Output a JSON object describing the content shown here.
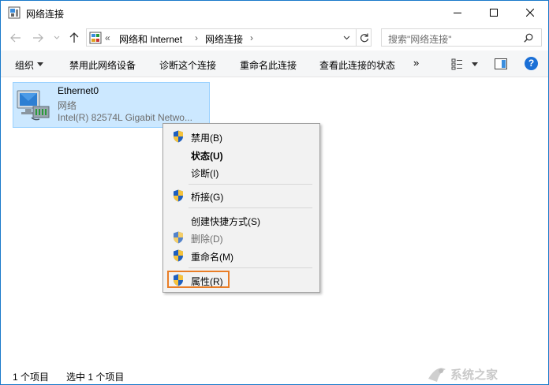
{
  "window": {
    "title": "网络连接",
    "icon": "network-connections-icon"
  },
  "titlebar_buttons": [
    "minimize-icon",
    "maximize-icon",
    "close-icon"
  ],
  "address": {
    "overflow": "«",
    "crumbs": [
      "网络和 Internet",
      "网络连接"
    ],
    "search_placeholder": "搜索\"网络连接\""
  },
  "commands": {
    "organize": "组织",
    "disable_device": "禁用此网络设备",
    "diagnose": "诊断这个连接",
    "rename": "重命名此连接",
    "view_status": "查看此连接的状态",
    "more": "»",
    "help": "?"
  },
  "connection": {
    "name": "Ethernet0",
    "type": "网络",
    "device": "Intel(R) 82574L Gigabit Netwo..."
  },
  "context_menu": {
    "items": [
      {
        "label": "禁用(B)",
        "shield": true,
        "bold": false,
        "disabled": false
      },
      {
        "label": "状态(U)",
        "shield": false,
        "bold": true,
        "disabled": false
      },
      {
        "label": "诊断(I)",
        "shield": false,
        "bold": false,
        "disabled": false
      },
      {
        "label": "桥接(G)",
        "shield": true,
        "bold": false,
        "disabled": false
      },
      {
        "label": "创建快捷方式(S)",
        "shield": false,
        "bold": false,
        "disabled": false
      },
      {
        "label": "删除(D)",
        "shield": true,
        "bold": false,
        "disabled": true
      },
      {
        "label": "重命名(M)",
        "shield": true,
        "bold": false,
        "disabled": false
      },
      {
        "label": "属性(R)",
        "shield": true,
        "bold": false,
        "disabled": false
      }
    ]
  },
  "status": {
    "count": "1 个项目",
    "selected": "选中 1 个项目"
  },
  "watermark": {
    "text": "系统之家"
  },
  "colors": {
    "selection_bg": "#cce8ff",
    "selection_border": "#99d1ff",
    "highlight_outline": "#e97d26",
    "help_blue": "#1a6fd6",
    "window_border": "#1979ca"
  }
}
